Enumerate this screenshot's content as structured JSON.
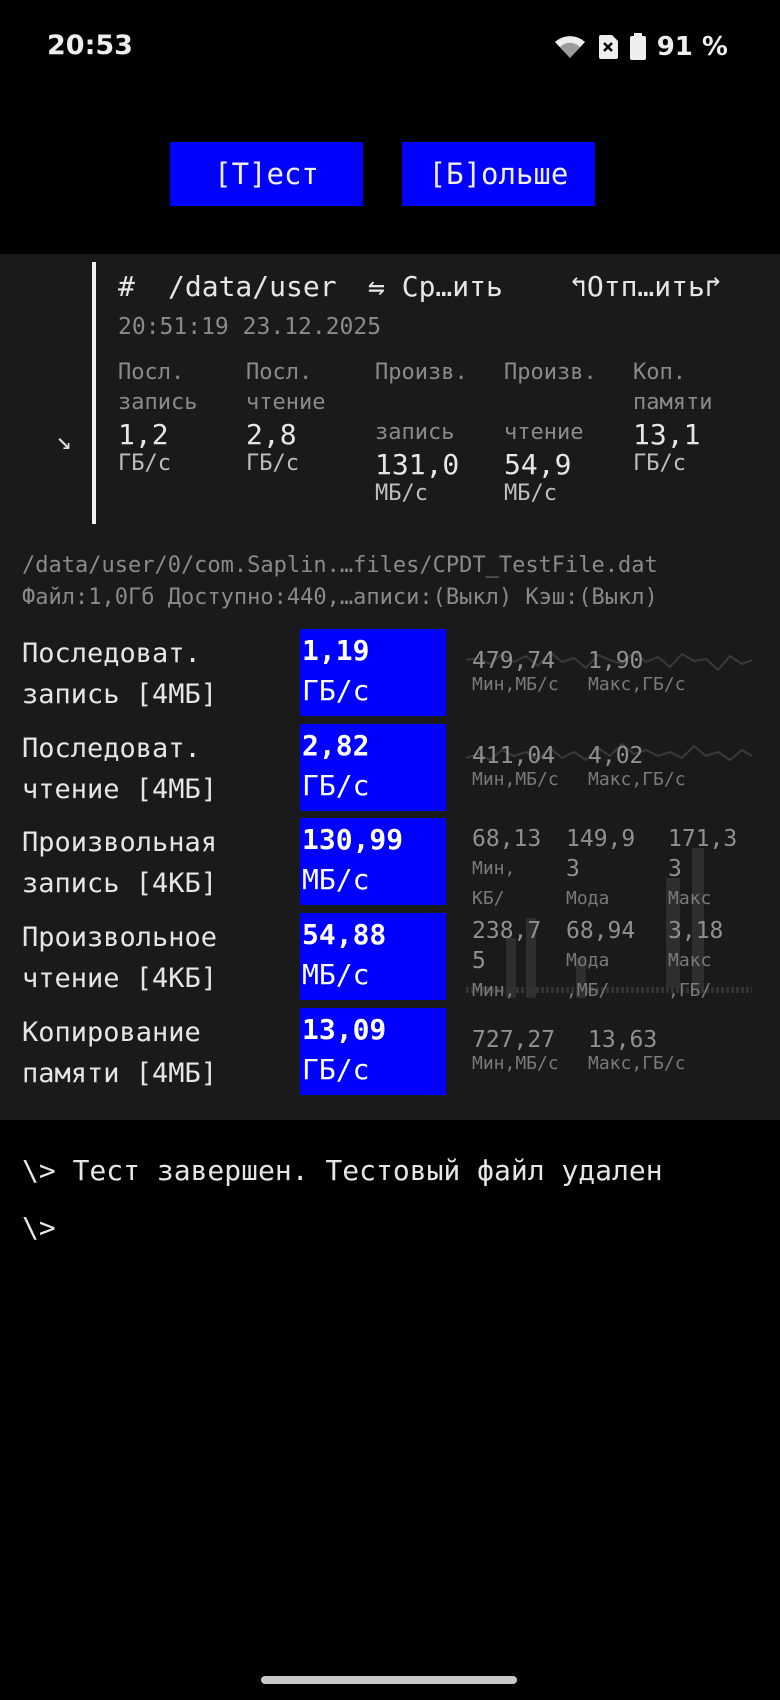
{
  "status": {
    "time": "20:53",
    "battery": "91 %",
    "icons": [
      "wifi-icon",
      "sim-off-icon",
      "battery-icon"
    ]
  },
  "buttons": {
    "test": "[Т]ест",
    "more": "[Б]ольше"
  },
  "history": {
    "hash": "#",
    "path": "/data/user",
    "compare": "⇋ Ср…ить",
    "send": "↰Отп…ить↱",
    "date": "20:51:19 23.12.2025",
    "arrow": "↘",
    "columns": [
      {
        "label": "Посл.\nзапись",
        "value": "1,2",
        "unit": "ГБ/с"
      },
      {
        "label": "Посл.\nчтение",
        "value": "2,8",
        "unit": "ГБ/с"
      },
      {
        "label": "Произв.\n\nзапись",
        "value": "131,0",
        "unit": "МБ/с"
      },
      {
        "label": "Произв.\n\nчтение",
        "value": "54,9",
        "unit": "МБ/с"
      },
      {
        "label": "Коп.\nпамяти",
        "value": "13,1",
        "unit": "ГБ/с"
      }
    ]
  },
  "file": {
    "path": "/data/user/0/com.Saplin.…files/CPDT_TestFile.dat",
    "info": "Файл:1,0Гб Доступно:440,…аписи:(Выкл) Кэш:(Выкл)"
  },
  "results": [
    {
      "label": "Последоват.\nзапись [4МБ]",
      "value": "1,19",
      "unit": "ГБ/с",
      "stats": [
        {
          "v": "479,74",
          "l": "Мин,МБ/с"
        },
        {
          "v": "1,90",
          "l": "Макс,ГБ/с"
        }
      ]
    },
    {
      "label": "Последоват.\nчтение [4МБ]",
      "value": "2,82",
      "unit": "ГБ/с",
      "stats": [
        {
          "v": "411,04",
          "l": "Мин,МБ/с"
        },
        {
          "v": "4,02",
          "l": "Макс,ГБ/с"
        }
      ]
    },
    {
      "label": "Произвольная\nзапись [4КБ]",
      "value": "130,99",
      "unit": "МБ/с",
      "stats": [
        {
          "v": "68,13",
          "l": "Мин,\nКБ/"
        },
        {
          "v": "149,9\n3",
          "l": "Мода"
        },
        {
          "v": "171,3\n3",
          "l": "Макс"
        }
      ]
    },
    {
      "label": "Произвольное\nчтение [4КБ]",
      "value": "54,88",
      "unit": "МБ/с",
      "stats": [
        {
          "v": "238,7\n5",
          "l": "Мин,"
        },
        {
          "v": "68,94",
          "l": "Мода\n,МБ/"
        },
        {
          "v": "3,18",
          "l": "Макс\n,ГБ/"
        }
      ]
    },
    {
      "label": "Копирование\nпамяти [4МБ]",
      "value": "13,09",
      "unit": "ГБ/с",
      "stats": [
        {
          "v": "727,27",
          "l": "Мин,МБ/с"
        },
        {
          "v": "13,63",
          "l": "Макс,ГБ/с"
        }
      ]
    }
  ],
  "console": {
    "line1": "\\> Тест завершен. Тестовый файл удален",
    "line2": "\\>"
  },
  "colors": {
    "accent": "#0000ff",
    "panel": "#1a1a1a",
    "background": "#000000"
  }
}
